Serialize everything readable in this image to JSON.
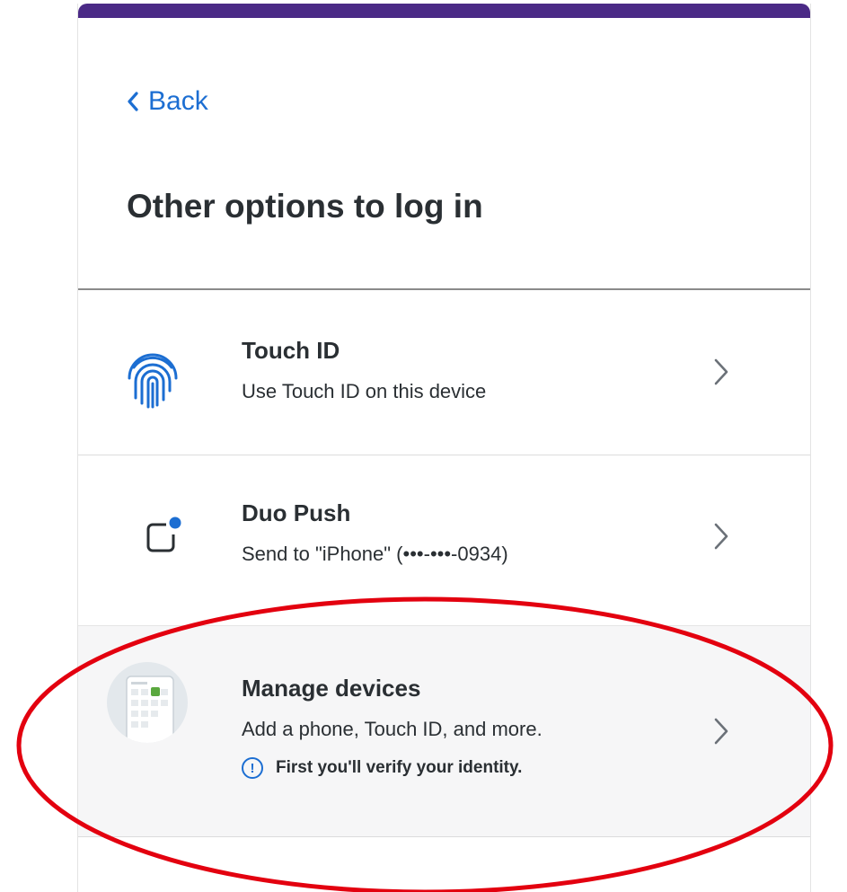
{
  "header": {
    "back_label": "Back",
    "title": "Other options to log in"
  },
  "options": [
    {
      "title": "Touch ID",
      "subtitle": "Use Touch ID on this device",
      "icon": "fingerprint-icon"
    },
    {
      "title": "Duo Push",
      "subtitle": "Send to \"iPhone\" (•••-•••-0934)",
      "icon": "push-notification-icon"
    },
    {
      "title": "Manage devices",
      "subtitle": "Add a phone, Touch ID, and more.",
      "note": "First you'll verify your identity.",
      "icon": "device-manager-illustration"
    }
  ],
  "colors": {
    "accent_bar": "#4b2a86",
    "link": "#1c6ed2",
    "highlight": "#e3000f"
  }
}
